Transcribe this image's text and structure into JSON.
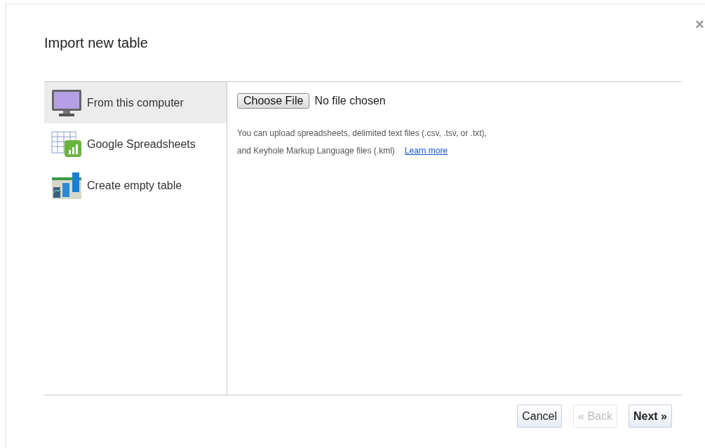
{
  "dialog": {
    "title": "Import new table",
    "close": "×"
  },
  "sources": [
    {
      "kind": "computer",
      "label": "From this computer",
      "selected": true
    },
    {
      "kind": "spreadsheet",
      "label": "Google Spreadsheets",
      "selected": false
    },
    {
      "kind": "table",
      "label": "Create empty table",
      "selected": false
    }
  ],
  "file_input": {
    "button": "Choose File",
    "status": "No file chosen"
  },
  "help": {
    "line_1": "You can upload spreadsheets, delimited text files (.csv, .tsv, or .txt),",
    "line_2": "and Keyhole Markup Language files (.kml)",
    "link": "Learn more"
  },
  "buttons": [
    {
      "label": "Cancel",
      "disabled": false,
      "primary": false
    },
    {
      "label": "« Back",
      "disabled": true,
      "primary": false
    },
    {
      "label": "Next »",
      "disabled": false,
      "primary": true
    }
  ]
}
